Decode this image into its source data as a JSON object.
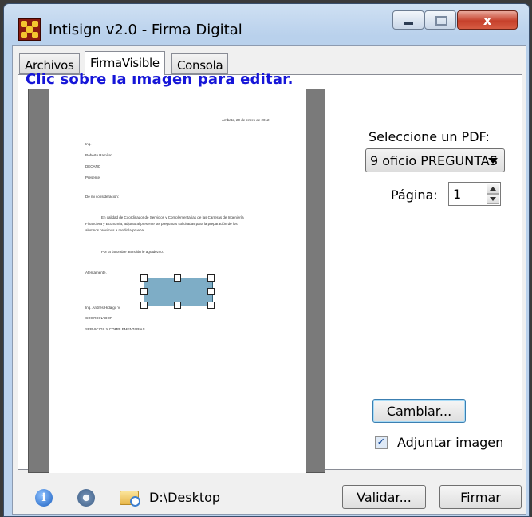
{
  "window": {
    "title": "Intisign v2.0 - Firma Digital",
    "close_symbol": "x"
  },
  "tabs": [
    {
      "label": "Archivos",
      "active": false
    },
    {
      "label": "FirmaVisible",
      "active": true
    },
    {
      "label": "Consola",
      "active": false
    }
  ],
  "firma_visible": {
    "hint": "Clic sobre la imagen para editar.",
    "pdf_label": "Seleccione un PDF:",
    "pdf_selected": "9 oficio PREGUNTAS",
    "page_label": "Página:",
    "page_value": "1",
    "change_button": "Cambiar...",
    "attach_image_label": "Adjuntar imagen",
    "attach_image_checked": true,
    "check_mark": "✓"
  },
  "document_preview": {
    "lines": [
      "Ambato, 20 de enero de 2012",
      "Ing.",
      "Roberto Ramírez",
      "DECANO",
      "Presente",
      "De mi consideración:",
      "En calidad de Coordinador de Servicios y Complementarias de las Carreras de Ingeniería",
      "Financiera y Economía, adjunto al presente las preguntas solicitadas para la preparación de los",
      "alumnos próximos a rendir la prueba.",
      "Por la favorable atención le agradezco.",
      "Atentamente,",
      "Ing. Andrés Hidalgo V.",
      "COORDINADOR",
      "SERVICIOS Y COMPLEMENTARIAS"
    ]
  },
  "status_bar": {
    "info_icon_glyph": "i",
    "path": "D:\\Desktop",
    "validate_button": "Validar...",
    "sign_button": "Firmar"
  },
  "icons": [
    "app-logo-icon",
    "minimize-icon",
    "maximize-icon",
    "close-icon",
    "info-icon",
    "settings-gear-icon",
    "folder-search-icon",
    "dropdown-arrow-icon",
    "spin-up-icon",
    "spin-down-icon",
    "checkbox-check-icon"
  ],
  "colors": {
    "hint_text": "#1616d8",
    "signature_box": "#7eadc6",
    "window_frame": "#b9d1ec",
    "close_button": "#c6402b"
  }
}
